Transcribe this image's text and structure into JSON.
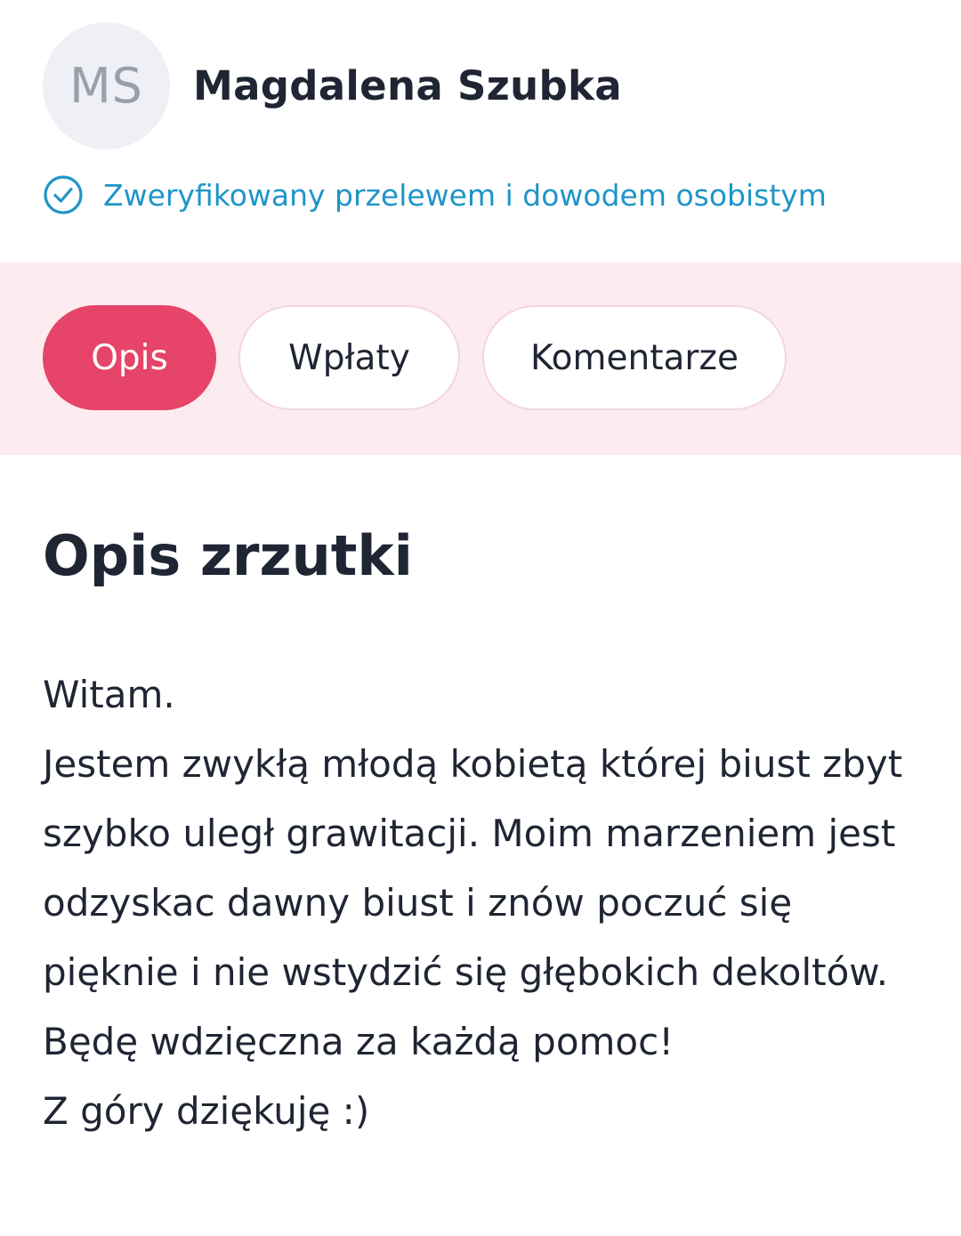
{
  "organizer": {
    "initials": "MS",
    "name": "Magdalena Szubka",
    "verified_text": "Zweryfikowany przelewem i dowodem osobistym",
    "verified_icon": "check-circle-icon"
  },
  "colors": {
    "accent": "#e64468",
    "tabs_background": "#fcebef",
    "verified": "#1f95c8",
    "text": "#1f2533",
    "avatar_background": "#eef0f5"
  },
  "tabs": [
    {
      "label": "Opis",
      "active": true
    },
    {
      "label": "Wpłaty",
      "active": false
    },
    {
      "label": "Komentarze",
      "active": false
    }
  ],
  "description": {
    "title": "Opis zrzutki",
    "lines": [
      "Witam.",
      "Jestem zwykłą młodą kobietą której biust zbyt szybko uległ grawitacji. Moim marzeniem jest odzyskac dawny biust i znów poczuć się pięknie i nie wstydzić się głębokich dekoltów.",
      "Będę wdzięczna za każdą pomoc!",
      "Z góry dziękuję :)"
    ]
  }
}
